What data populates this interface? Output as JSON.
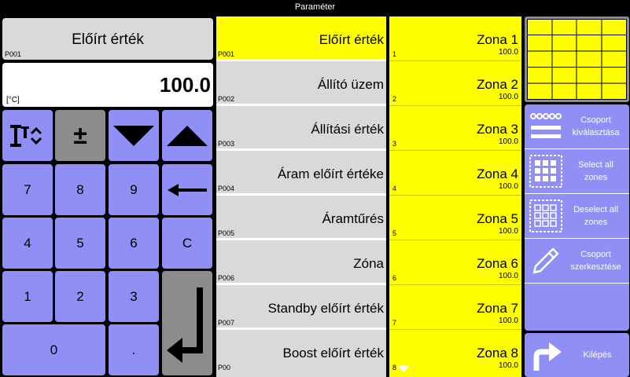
{
  "window": {
    "title": "Paraméter"
  },
  "param": {
    "name": "Előírt érték",
    "code": "P001",
    "value": "100.0",
    "unit": "[°C]"
  },
  "keypad": {
    "row1": [
      {
        "name": "cursor-select-key",
        "icon": "cursor-updown-icon"
      },
      {
        "name": "sign-toggle-key",
        "label": "±"
      },
      {
        "name": "arrow-down-key",
        "icon": "triangle-down-icon"
      },
      {
        "name": "arrow-up-key",
        "icon": "triangle-up-icon"
      }
    ],
    "k7": "7",
    "k8": "8",
    "k9": "9",
    "k4": "4",
    "k5": "5",
    "k6": "6",
    "kc": "C",
    "k1": "1",
    "k2": "2",
    "k3": "3",
    "k0": "0",
    "kdot": ".",
    "backspace_icon": "left-arrow-icon",
    "enter_icon": "enter-arrow-icon"
  },
  "params": [
    {
      "label": "Előírt érték",
      "code": "P001",
      "selected": true
    },
    {
      "label": "Állító üzem",
      "code": "P002"
    },
    {
      "label": "Állítási érték",
      "code": "P003"
    },
    {
      "label": "Áram előírt értéke",
      "code": "P004"
    },
    {
      "label": "Áramtűrés",
      "code": "P005"
    },
    {
      "label": "Zóna",
      "code": "P006"
    },
    {
      "label": "Standby előírt érték",
      "code": "P007"
    },
    {
      "label": "Boost előírt érték",
      "code": "P00"
    }
  ],
  "zones": [
    {
      "name": "Zona 1",
      "num": "1",
      "value": "100.0"
    },
    {
      "name": "Zona 2",
      "num": "2",
      "value": "100.0"
    },
    {
      "name": "Zona 3",
      "num": "3",
      "value": "100.0"
    },
    {
      "name": "Zona 4",
      "num": "4",
      "value": "100.0"
    },
    {
      "name": "Zona 5",
      "num": "5",
      "value": "100.0"
    },
    {
      "name": "Zona 6",
      "num": "6",
      "value": "100.0"
    },
    {
      "name": "Zona 7",
      "num": "7",
      "value": "100.0"
    },
    {
      "name": "Zona 8",
      "num": "8",
      "value": "100.0"
    }
  ],
  "actions": {
    "group_select": {
      "line1": "Csoport",
      "line2": "kiválasztása",
      "icon": "group-select-icon"
    },
    "select_all": {
      "line1": "Select all",
      "line2": "zones",
      "icon": "select-all-icon"
    },
    "deselect_all": {
      "line1": "Deselect all",
      "line2": "zones",
      "icon": "deselect-all-icon"
    },
    "group_edit": {
      "line1": "Csoport",
      "line2": "szerkesztése",
      "icon": "pencil-icon"
    }
  },
  "exit": {
    "label": "Kilépés",
    "icon": "exit-arrow-icon"
  },
  "colors": {
    "key": "#8f8ff5",
    "selected": "#ffff00",
    "list_bg": "#d9d9d9",
    "gray_key": "#8c8c8c"
  }
}
